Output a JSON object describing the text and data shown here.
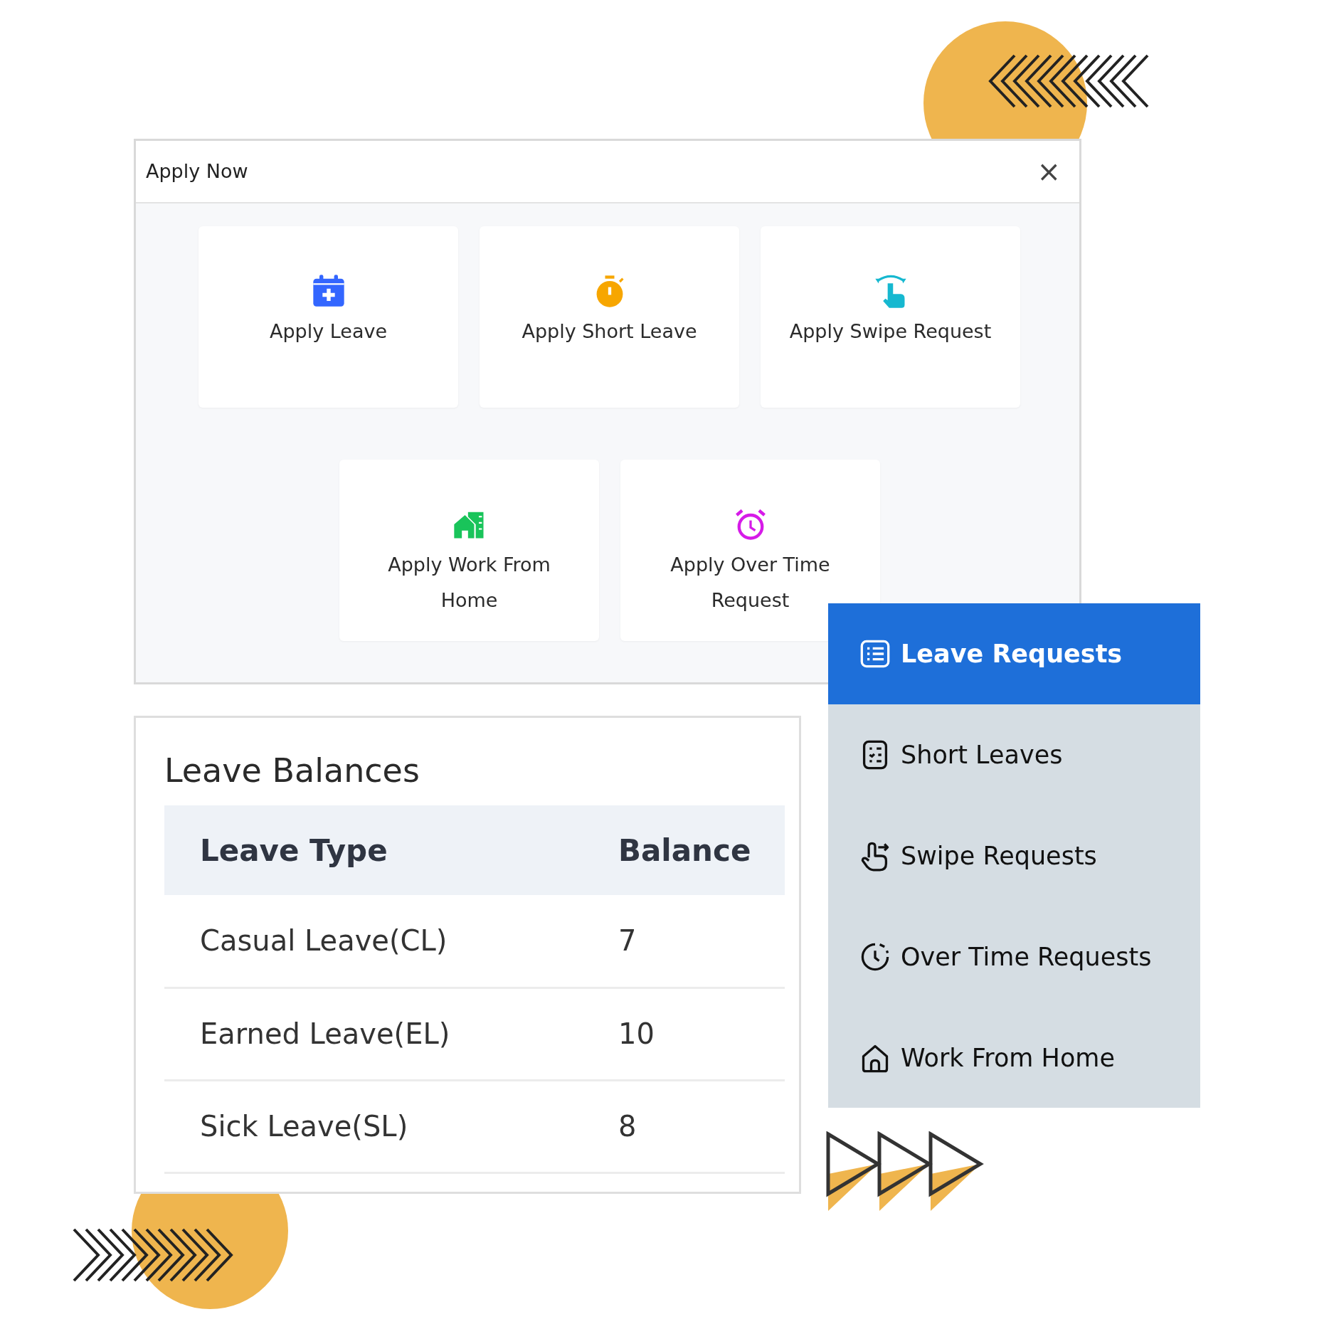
{
  "apply_dialog": {
    "title": "Apply Now",
    "close": "×",
    "card_rows": [
      [
        {
          "label": "Apply Leave"
        },
        {
          "label": "Apply Short Leave"
        },
        {
          "label": "Apply Swipe Request"
        }
      ],
      [
        {
          "label": "Apply Work From Home"
        },
        {
          "label": "Apply Over Time Request"
        }
      ]
    ]
  },
  "leave_balances": {
    "title": "Leave Balances",
    "columns": [
      "Leave Type",
      "Balance"
    ],
    "rows": [
      [
        "Casual Leave(CL)",
        "7"
      ],
      [
        "Earned Leave(EL)",
        "10"
      ],
      [
        "Sick Leave(SL)",
        "8"
      ]
    ]
  },
  "sidebar": {
    "items": [
      {
        "label": "Leave Requests",
        "selected": true
      },
      {
        "label": "Short Leaves",
        "selected": false
      },
      {
        "label": "Swipe Requests",
        "selected": false
      },
      {
        "label": "Over Time Requests",
        "selected": false
      },
      {
        "label": "Work From Home",
        "selected": false
      }
    ]
  }
}
